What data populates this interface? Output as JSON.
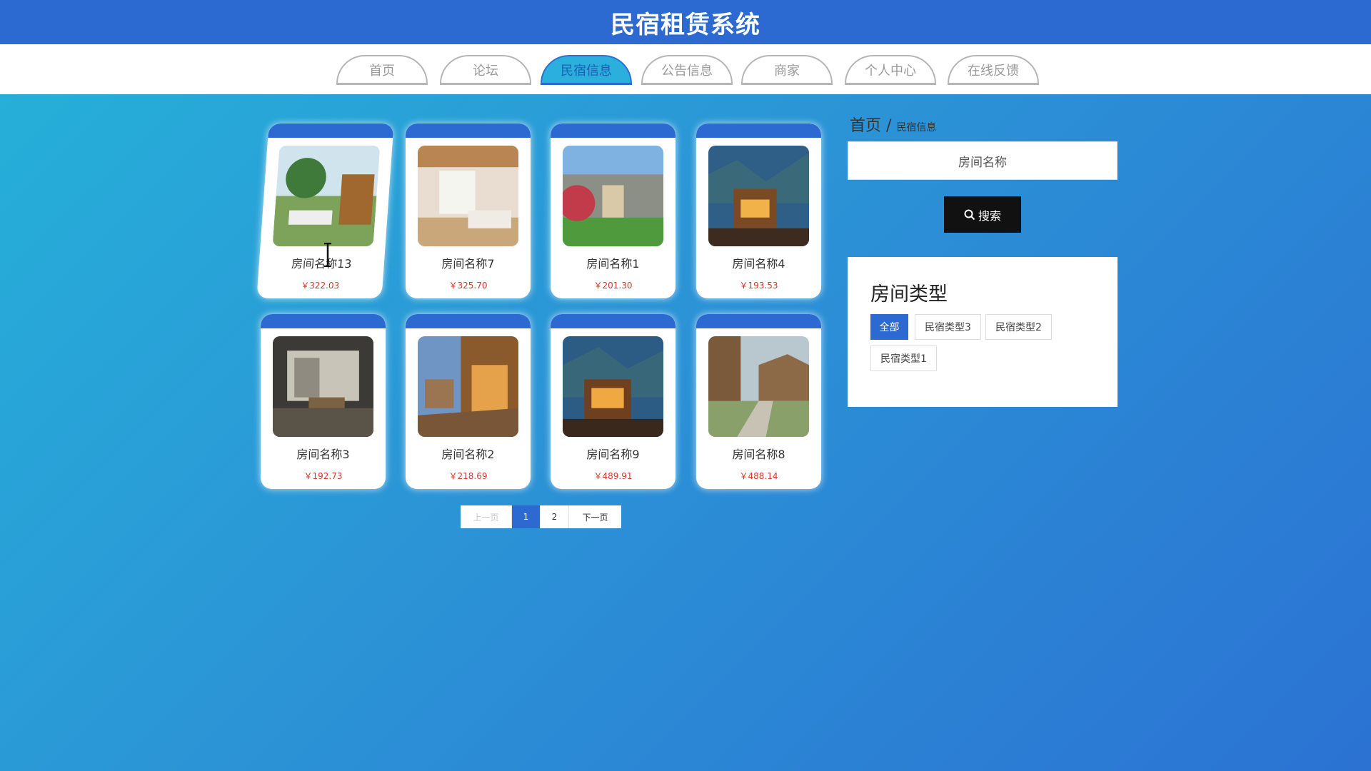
{
  "header": {
    "title": "民宿租赁系统"
  },
  "nav": {
    "tabs": [
      {
        "label": "首页",
        "active": false
      },
      {
        "label": "论坛",
        "active": false
      },
      {
        "label": "民宿信息",
        "active": true
      },
      {
        "label": "公告信息",
        "active": false
      },
      {
        "label": "商家",
        "active": false
      },
      {
        "label": "个人中心",
        "active": false
      },
      {
        "label": "在线反馈",
        "active": false
      }
    ]
  },
  "breadcrumb": {
    "home": "首页",
    "sep": "/",
    "current": "民宿信息"
  },
  "search": {
    "placeholder": "房间名称",
    "button_label": "搜索"
  },
  "room_types": {
    "title": "房间类型",
    "options": [
      {
        "label": "全部",
        "active": true
      },
      {
        "label": "民宿类型3",
        "active": false
      },
      {
        "label": "民宿类型2",
        "active": false
      },
      {
        "label": "民宿类型1",
        "active": false
      }
    ]
  },
  "rooms": [
    {
      "name": "房间名称13",
      "price": "￥322.03"
    },
    {
      "name": "房间名称7",
      "price": "￥325.70"
    },
    {
      "name": "房间名称1",
      "price": "￥201.30"
    },
    {
      "name": "房间名称4",
      "price": "￥193.53"
    },
    {
      "name": "房间名称3",
      "price": "￥192.73"
    },
    {
      "name": "房间名称2",
      "price": "￥218.69"
    },
    {
      "name": "房间名称9",
      "price": "￥489.91"
    },
    {
      "name": "房间名称8",
      "price": "￥488.14"
    }
  ],
  "pagination": {
    "prev": "上一页",
    "pages": [
      "1",
      "2"
    ],
    "current": "1",
    "next": "下一页"
  }
}
